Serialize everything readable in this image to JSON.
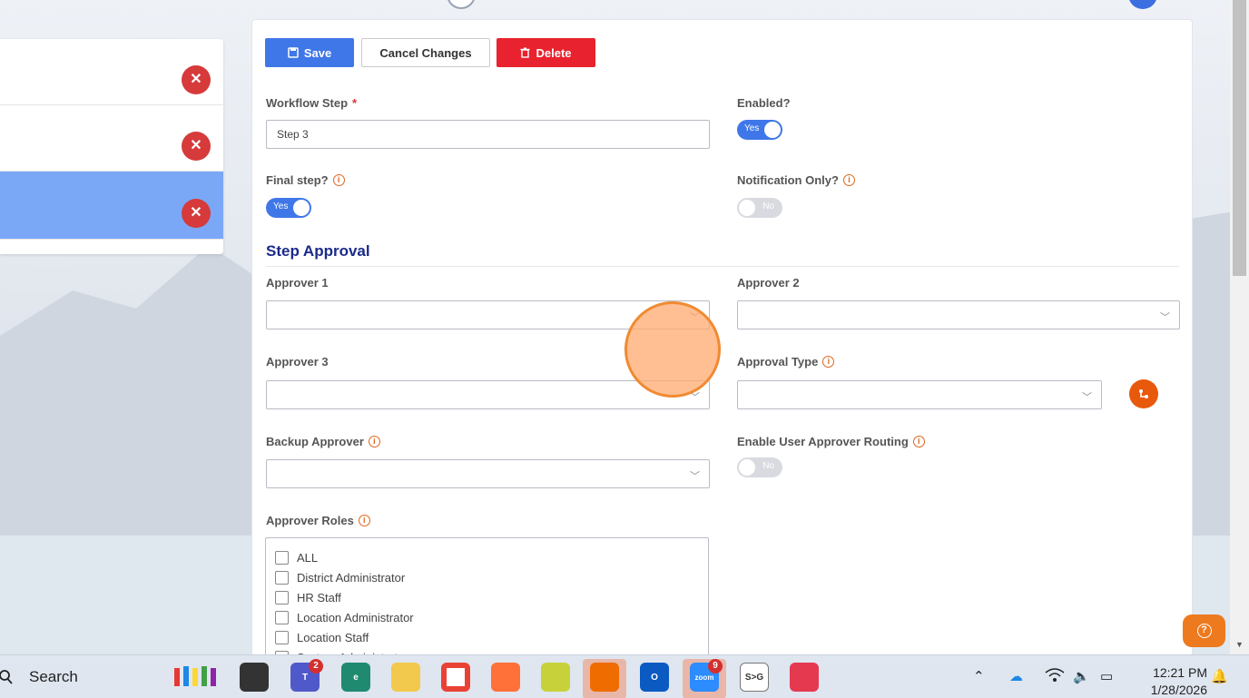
{
  "toolbar": {
    "save_label": "Save",
    "cancel_label": "Cancel Changes",
    "delete_label": "Delete"
  },
  "form": {
    "workflow_step_label": "Workflow Step",
    "workflow_step_required": "*",
    "workflow_step_value": "Step 3",
    "enabled_label": "Enabled?",
    "enabled_value": "Yes",
    "final_step_label": "Final step?",
    "final_step_value": "Yes",
    "notification_only_label": "Notification Only?",
    "notification_only_value": "No",
    "section_title": "Step Approval",
    "approver1_label": "Approver 1",
    "approver2_label": "Approver 2",
    "approver3_label": "Approver 3",
    "approval_type_label": "Approval Type",
    "backup_approver_label": "Backup Approver",
    "enable_routing_label": "Enable User Approver Routing",
    "enable_routing_value": "No",
    "approver_roles_label": "Approver Roles",
    "roles": [
      "ALL",
      "District Administrator",
      "HR Staff",
      "Location Administrator",
      "Location Staff",
      "System Administrator"
    ]
  },
  "taskbar": {
    "search_label": "Search",
    "teams_badge": "2",
    "zoom_badge": "9",
    "zoom_label": "zoom",
    "sg_label": "S>G",
    "time": "12:21 PM",
    "date": "1/28/2026"
  },
  "colors": {
    "primary": "#3f77e8",
    "danger": "#e8222e",
    "accent_orange": "#e8590c",
    "section_title": "#1b2b8a"
  }
}
